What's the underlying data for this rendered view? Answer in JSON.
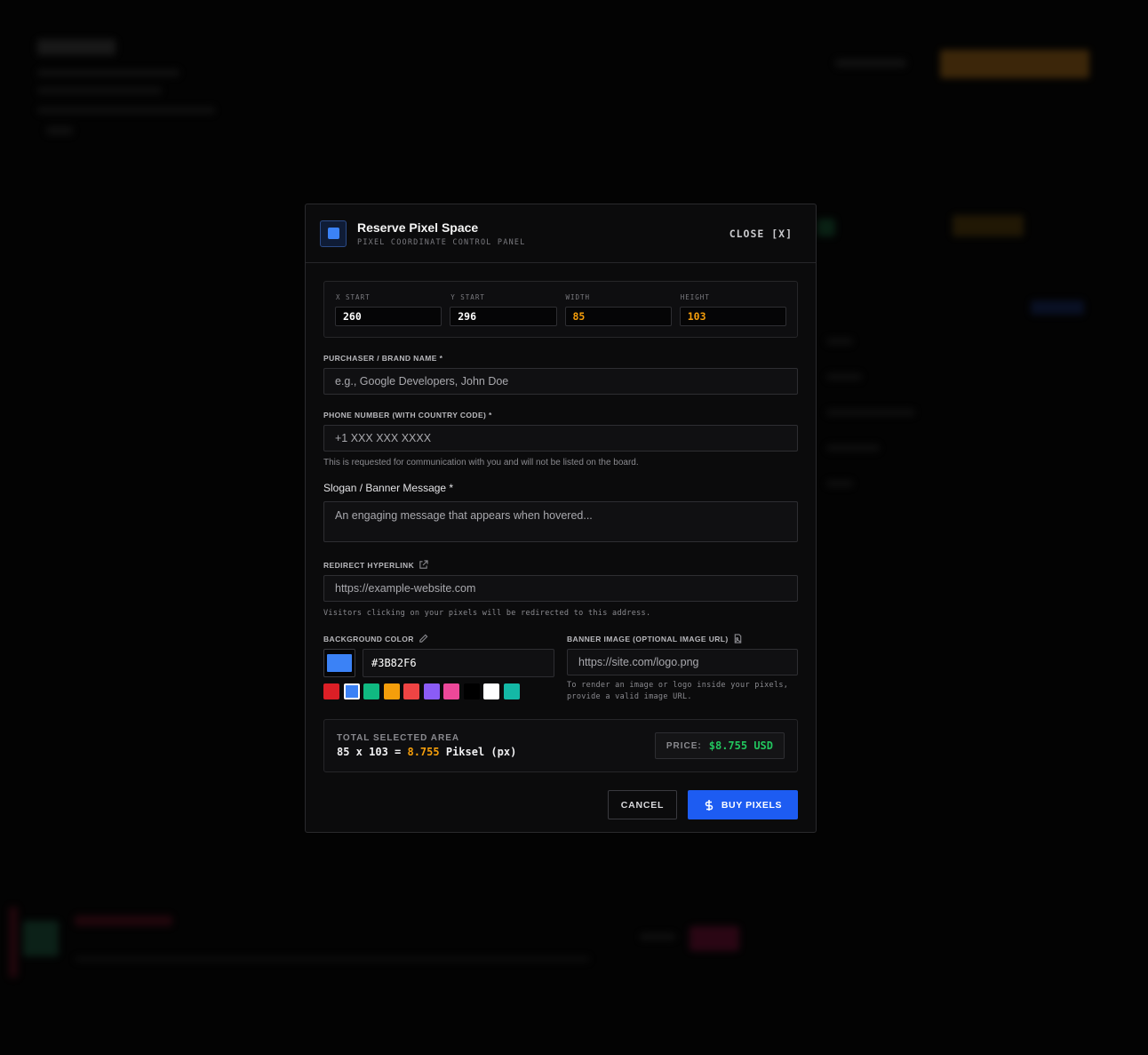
{
  "modal": {
    "title": "Reserve Pixel Space",
    "subtitle": "PIXEL COORDINATE CONTROL PANEL",
    "close_label": "CLOSE [X]"
  },
  "coordinates": {
    "x_start": {
      "label": "X START",
      "value": "260"
    },
    "y_start": {
      "label": "Y START",
      "value": "296"
    },
    "width": {
      "label": "WIDTH",
      "value": "85"
    },
    "height": {
      "label": "HEIGHT",
      "value": "103"
    }
  },
  "form": {
    "name": {
      "label": "PURCHASER / BRAND NAME *",
      "placeholder": "e.g., Google Developers, John Doe"
    },
    "phone": {
      "label": "PHONE NUMBER (WITH COUNTRY CODE) *",
      "placeholder": "+1 XXX XXX XXXX",
      "hint": "This is requested for communication with you and will not be listed on the board."
    },
    "slogan": {
      "label": "Slogan / Banner Message *",
      "placeholder": "An engaging message that appears when hovered..."
    },
    "link": {
      "label": "REDIRECT HYPERLINK",
      "placeholder": "https://example-website.com",
      "hint": "Visitors clicking on your pixels will be redirected to this address."
    },
    "color": {
      "label": "BACKGROUND COLOR",
      "value": "#3B82F6",
      "selected_index": 1,
      "palette": [
        "#dc1f26",
        "#3b82f6",
        "#10b981",
        "#f59e0b",
        "#ef4444",
        "#8b5cf6",
        "#ec4899",
        "#000000",
        "#ffffff",
        "#14b8a6"
      ]
    },
    "banner": {
      "label": "BANNER IMAGE (OPTIONAL IMAGE URL)",
      "placeholder": "https://site.com/logo.png",
      "hint_line1": "To render an image or logo inside your pixels,",
      "hint_line2": "provide a valid image URL."
    }
  },
  "summary": {
    "label": "TOTAL SELECTED AREA",
    "formula": "85 x 103 =",
    "total": "8.755",
    "unit": "Piksel (px)",
    "price_label": "PRICE:",
    "price_value": "$8.755 USD"
  },
  "actions": {
    "cancel": "CANCEL",
    "buy": "BUY PIXELS"
  },
  "colors": {
    "accent_blue": "#3b82f6",
    "button_blue": "#1d5cf2",
    "accent_orange": "#f59e0b",
    "price_green": "#22c55e"
  }
}
